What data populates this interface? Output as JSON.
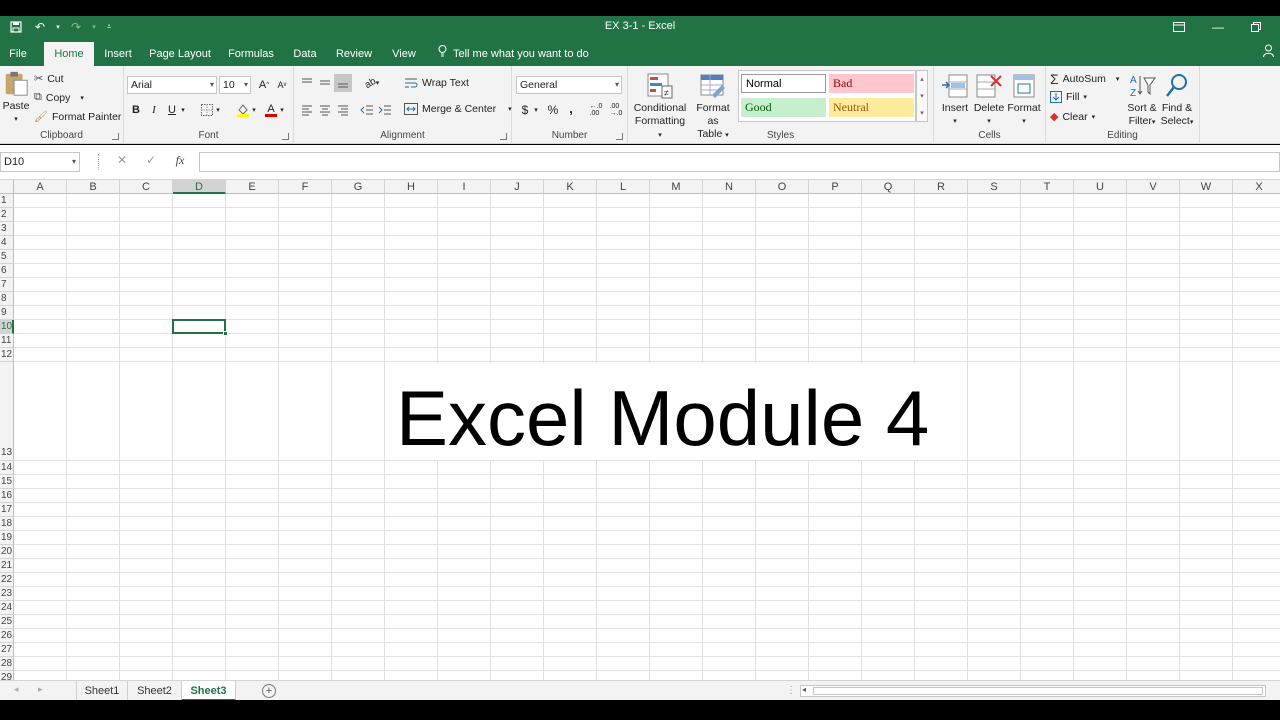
{
  "window": {
    "title": "EX 3-1  -  Excel",
    "qat": [
      "save-icon",
      "undo-icon",
      "redo-icon",
      "customize-icon"
    ]
  },
  "tabs": [
    "File",
    "Home",
    "Insert",
    "Page Layout",
    "Formulas",
    "Data",
    "Review",
    "View"
  ],
  "tell_me": "Tell me what you want to do",
  "clipboard": {
    "label": "Clipboard",
    "paste": "Paste",
    "cut": "Cut",
    "copy": "Copy",
    "format_painter": "Format Painter"
  },
  "font": {
    "label": "Font",
    "family": "Arial",
    "size": "10",
    "bold": "B",
    "italic": "I",
    "underline": "U"
  },
  "alignment": {
    "label": "Alignment",
    "wrap_text": "Wrap Text",
    "merge_center": "Merge & Center"
  },
  "number": {
    "label": "Number",
    "format": "General",
    "currency": "$",
    "percent": "%",
    "comma": ","
  },
  "styles": {
    "label": "Styles",
    "conditional_1": "Conditional",
    "conditional_2": "Formatting",
    "format_table_1": "Format as",
    "format_table_2": "Table",
    "normal": "Normal",
    "bad": "Bad",
    "good": "Good",
    "neutral": "Neutral"
  },
  "cells": {
    "label": "Cells",
    "insert": "Insert",
    "delete": "Delete",
    "format": "Format"
  },
  "editing": {
    "label": "Editing",
    "autosum": "AutoSum",
    "fill": "Fill",
    "clear": "Clear",
    "sort_1": "Sort &",
    "sort_2": "Filter",
    "find_1": "Find &",
    "find_2": "Select"
  },
  "formula_bar": {
    "name_box": "D10",
    "fx": "fx",
    "formula": ""
  },
  "columns": [
    "A",
    "B",
    "C",
    "D",
    "E",
    "F",
    "G",
    "H",
    "I",
    "J",
    "K",
    "L",
    "M",
    "N",
    "O",
    "P",
    "Q",
    "R",
    "S",
    "T",
    "U",
    "V",
    "W",
    "X"
  ],
  "selected_column": "D",
  "rows": [
    "1",
    "2",
    "3",
    "4",
    "5",
    "6",
    "7",
    "8",
    "9",
    "10",
    "11",
    "12",
    "13",
    "14",
    "15",
    "16",
    "17",
    "18",
    "19",
    "20",
    "21",
    "22",
    "23",
    "24",
    "25",
    "26",
    "27",
    "28",
    "29"
  ],
  "selected_row": "10",
  "cell_text": "Excel Module 4",
  "sheets": [
    "Sheet1",
    "Sheet2",
    "Sheet3"
  ],
  "active_sheet": "Sheet3",
  "colors": {
    "brand": "#217346",
    "bad_bg": "#ffc7ce",
    "bad_fg": "#9c0006",
    "good_bg": "#c6efce",
    "good_fg": "#006100",
    "neutral_bg": "#ffeb9c",
    "neutral_fg": "#9c5700"
  }
}
